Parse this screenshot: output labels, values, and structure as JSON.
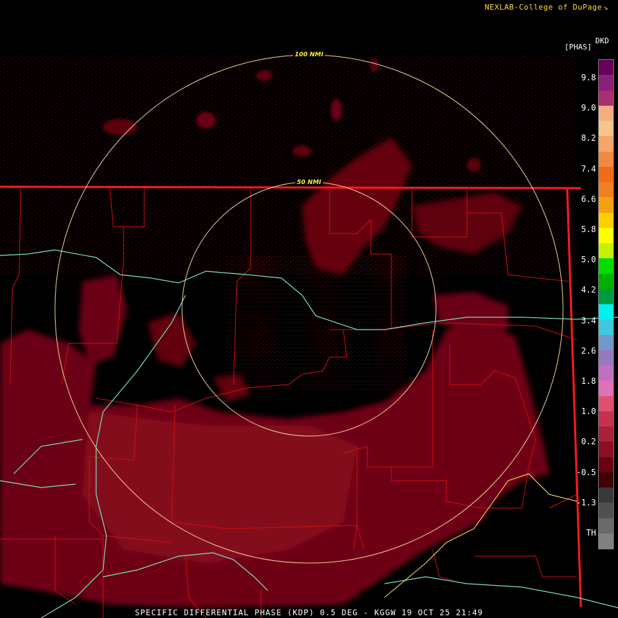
{
  "credit": "NEXLAB-College of DuPage",
  "colorbar": {
    "unit": "[PHAS]",
    "product": "DKD",
    "labels": [
      "9.8",
      "9.0",
      "8.2",
      "7.4",
      "6.6",
      "5.8",
      "5.0",
      "4.2",
      "3.4",
      "2.6",
      "1.8",
      "1.0",
      "0.2",
      "-0.5",
      "-1.3",
      "TH"
    ],
    "colors": [
      "#66005a",
      "#8a1f7a",
      "#a8306e",
      "#f2b080",
      "#f7c48c",
      "#f5a66b",
      "#f08a40",
      "#f06a18",
      "#f28020",
      "#f7a010",
      "#ffd000",
      "#ffff00",
      "#c8f000",
      "#00dc00",
      "#00b000",
      "#009a40",
      "#00f0f0",
      "#40c8dc",
      "#7098c8",
      "#9878c0",
      "#c070c0",
      "#e070b8",
      "#e05070",
      "#c83050",
      "#a8203a",
      "#8a1020",
      "#6a0010",
      "#400008",
      "#383838",
      "#505050",
      "#6a6a6a",
      "#808080"
    ]
  },
  "range_rings": [
    "100 NMI",
    "50 NMI"
  ],
  "footer": "SPECIFIC DIFFERENTIAL PHASE (KDP) 0.5 DEG - KGGW 19 OCT 25 21:49"
}
